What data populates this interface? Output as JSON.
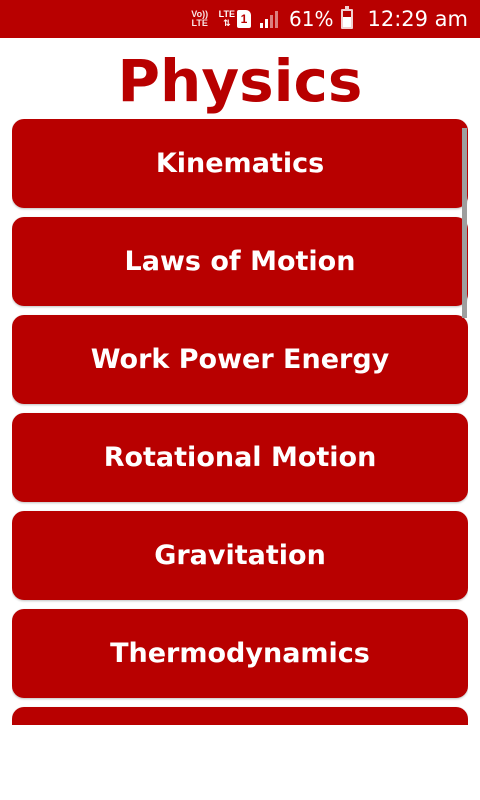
{
  "status_bar": {
    "volte_label": "Vo)) LTE",
    "lte_label": "LTE",
    "sim_slot": "1",
    "signal_icon": "signal-bars-icon",
    "battery_percent": "61%",
    "battery_level": 0.61,
    "time": "12:29 am",
    "background_color": "#b80000"
  },
  "page": {
    "title": "Physics",
    "accent_color": "#b80000"
  },
  "topics": [
    {
      "label": "Kinematics"
    },
    {
      "label": "Laws of Motion"
    },
    {
      "label": "Work Power Energy"
    },
    {
      "label": "Rotational Motion"
    },
    {
      "label": "Gravitation"
    },
    {
      "label": "Thermodynamics"
    },
    {
      "label": ""
    }
  ]
}
